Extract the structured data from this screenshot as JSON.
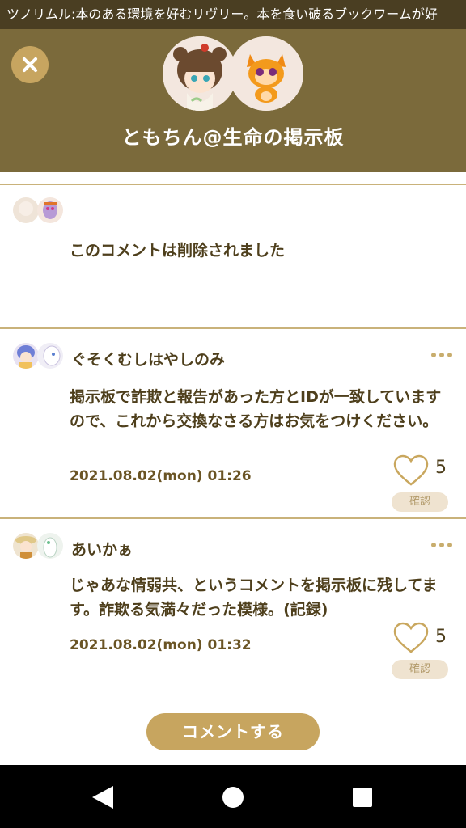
{
  "ticker": {
    "text": "ツノリムル:本のある環境を好むリヴリー。本を食い破るブックワームが好"
  },
  "header": {
    "title": "ともちん@生命の掲示板"
  },
  "comments": [
    {
      "author": "",
      "body": "このコメントは削除されました",
      "date": "",
      "likes": "",
      "confirm_label": ""
    },
    {
      "author": "ぐそくむしはやしのみ",
      "body": "掲示板で詐欺と報告があった方とIDが一致していますので、これから交換なさる方はお気をつけください。",
      "date": "2021.08.02(mon) 01:26",
      "likes": "5",
      "confirm_label": "確認"
    },
    {
      "author": "あいかぁ",
      "body": "じゃあな情弱共、というコメントを掲示板に残してます。詐欺る気満々だった模様。(記録)",
      "date": "2021.08.02(mon) 01:32",
      "likes": "5",
      "confirm_label": "確認"
    }
  ],
  "actions": {
    "comment_button": "コメントする"
  },
  "icons": {
    "close": "close-icon",
    "more": "more-dots-icon",
    "like": "heart-icon",
    "back": "back-icon",
    "home": "home-icon",
    "recent": "recent-apps-icon"
  },
  "colors": {
    "header_bg": "#7b6a3b",
    "accent": "#c7a55f",
    "text": "#4e3f1c"
  }
}
